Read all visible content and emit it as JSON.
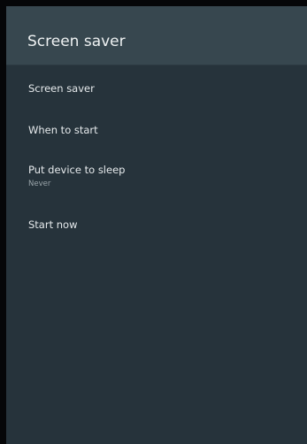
{
  "header": {
    "title": "Screen saver"
  },
  "items": [
    {
      "label": "Screen saver",
      "sub": ""
    },
    {
      "label": "When to start",
      "sub": ""
    },
    {
      "label": "Put device to sleep",
      "sub": "Never"
    },
    {
      "label": "Start now",
      "sub": ""
    }
  ],
  "colors": {
    "panel": "#26333b",
    "header": "#37474f",
    "text": "#e6eaec",
    "subtext": "#9aa5aa"
  }
}
